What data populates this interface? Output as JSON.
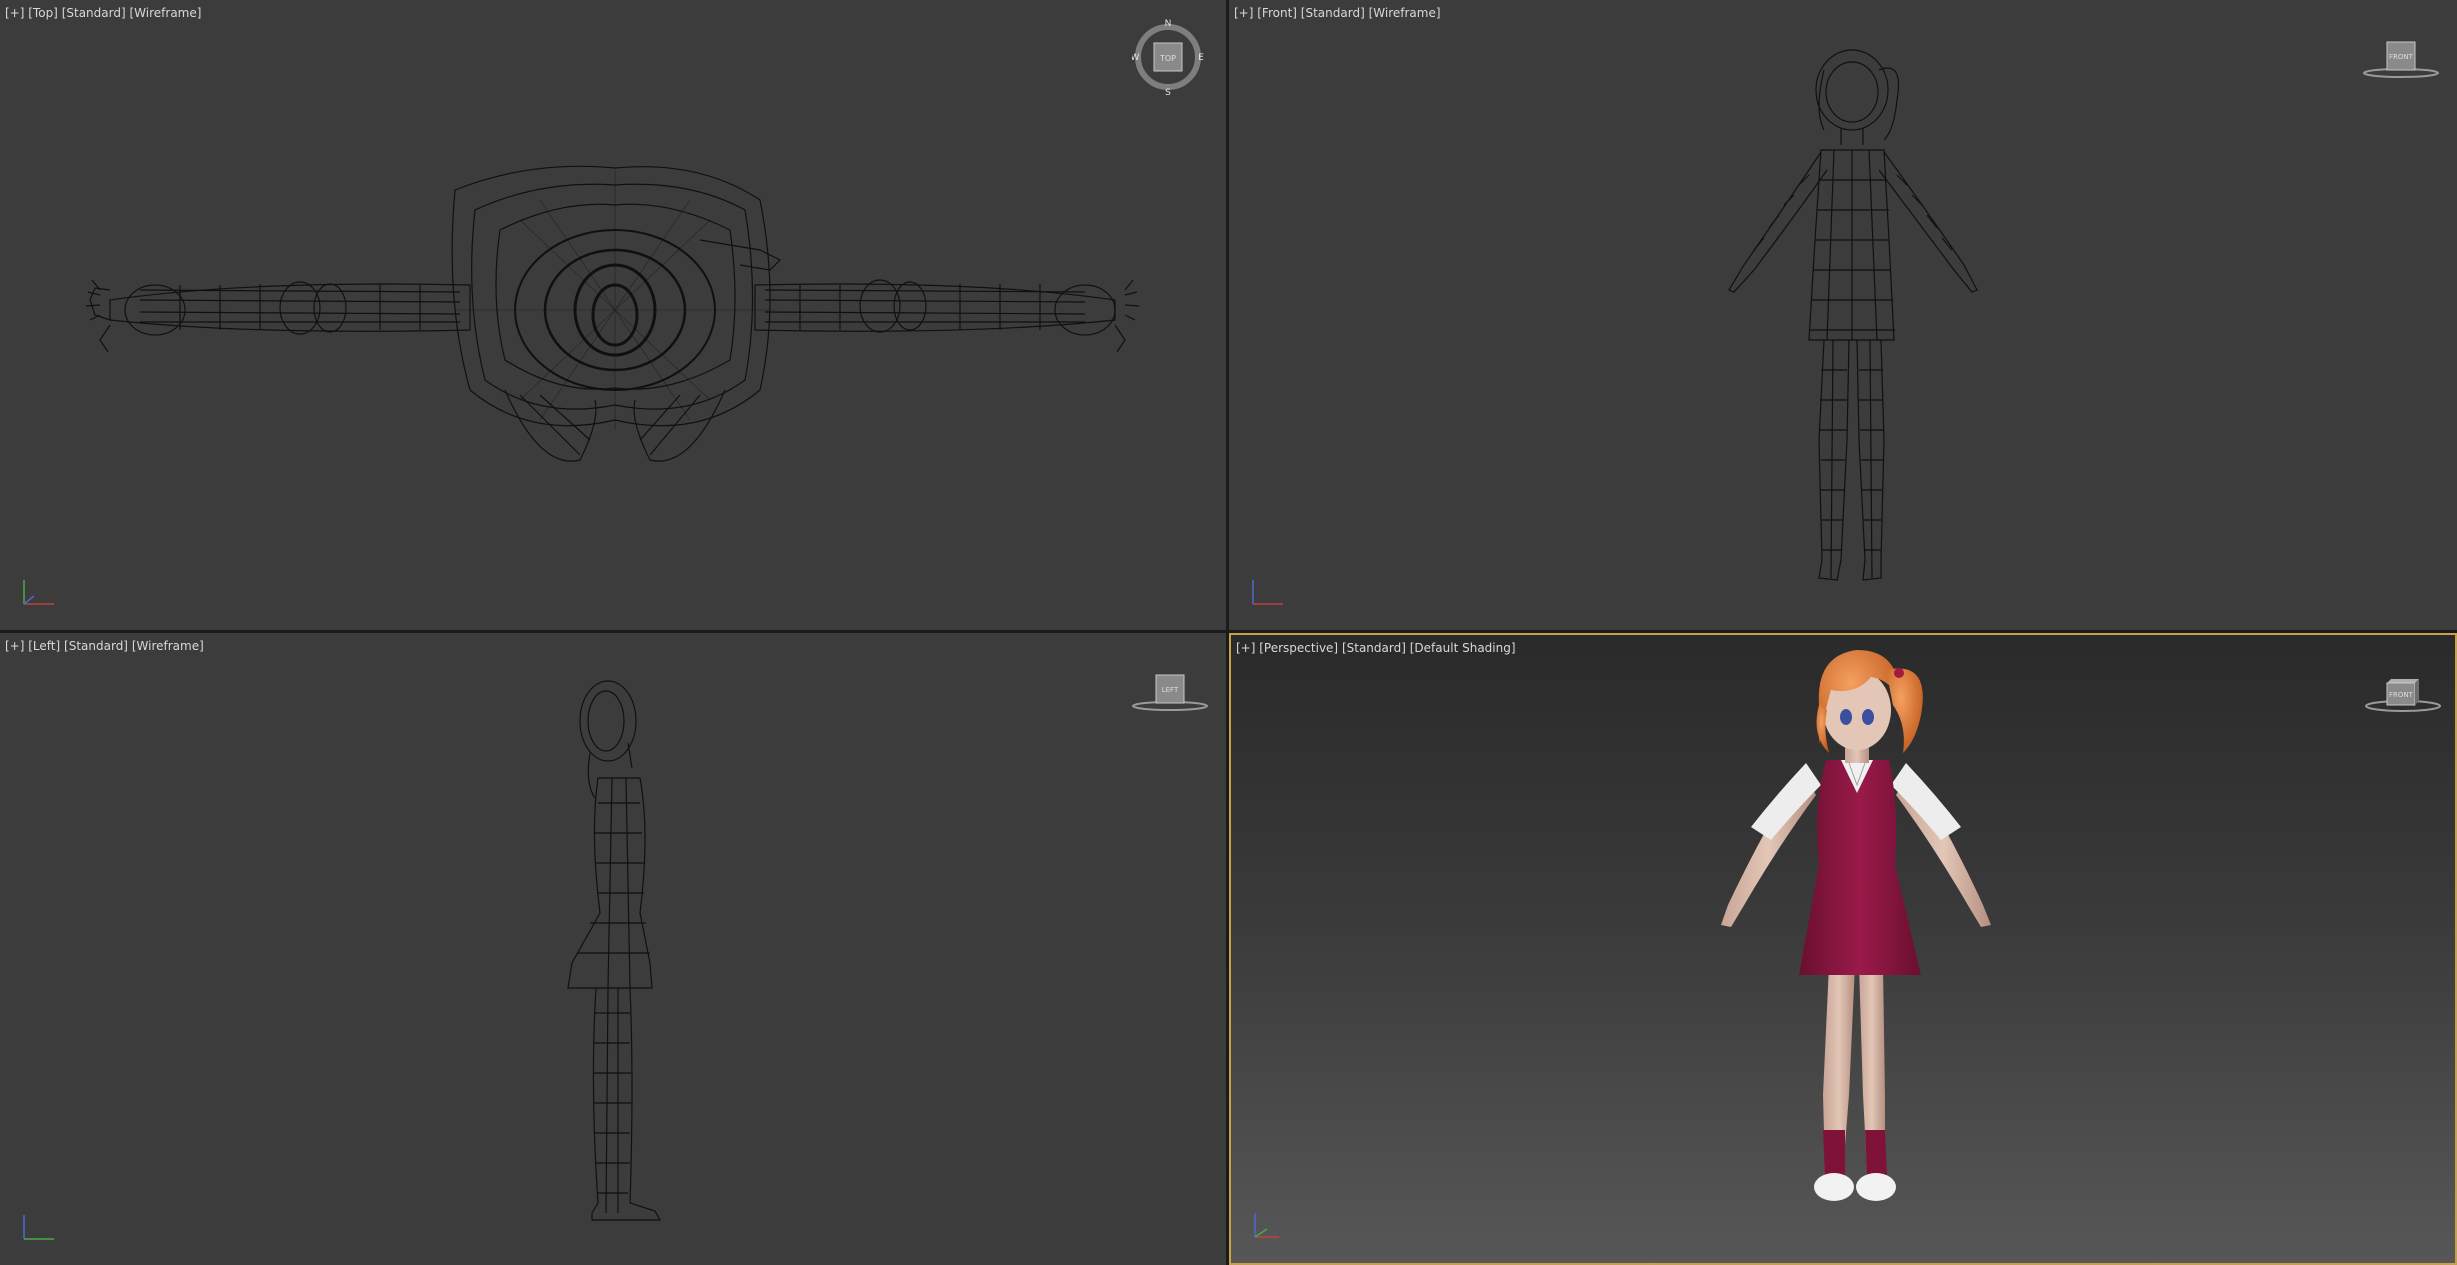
{
  "viewports": {
    "top": {
      "menu": "[+]",
      "view": "[Top]",
      "style": "[Standard]",
      "shading": "[Wireframe]",
      "cube_label": "TOP",
      "compass": {
        "n": "N",
        "s": "S",
        "e": "E",
        "w": "W"
      }
    },
    "front": {
      "menu": "[+]",
      "view": "[Front]",
      "style": "[Standard]",
      "shading": "[Wireframe]",
      "cube_label": "FRONT"
    },
    "left": {
      "menu": "[+]",
      "view": "[Left]",
      "style": "[Standard]",
      "shading": "[Wireframe]",
      "cube_label": "LEFT"
    },
    "perspective": {
      "menu": "[+]",
      "view": "[Perspective]",
      "style": "[Standard]",
      "shading": "[Default Shading]",
      "cube_label": "FRONT",
      "active": true
    }
  },
  "colors": {
    "viewport_bg": "#3c3c3c",
    "active_border": "#c8a24a",
    "wire": "#0c0c0c",
    "hair": "#e07a2e",
    "dress": "#8a1640",
    "shirt": "#e8e8e8",
    "skin": "#d9b9a6"
  }
}
